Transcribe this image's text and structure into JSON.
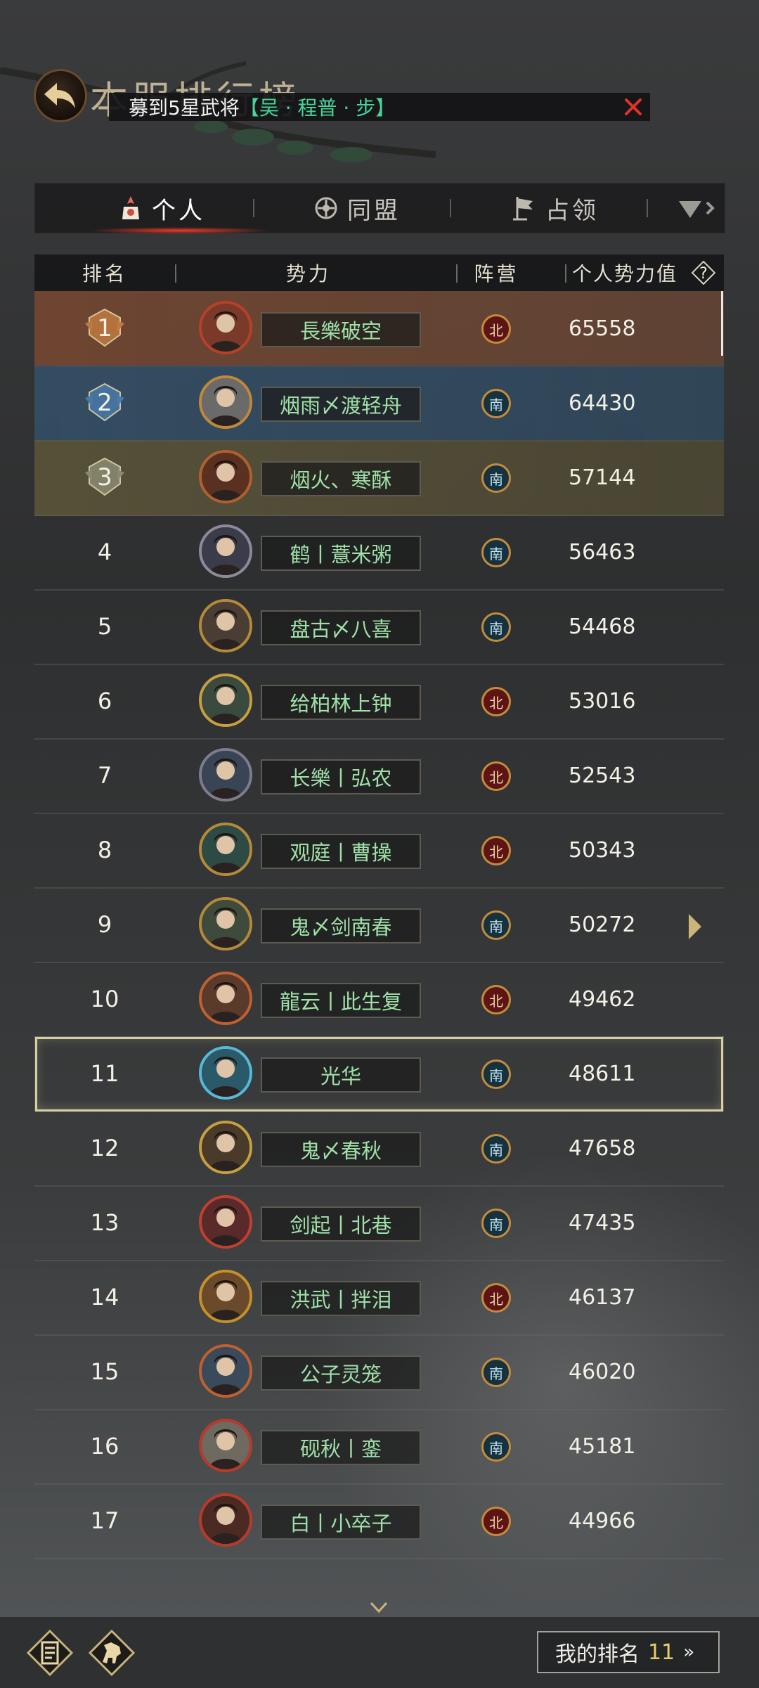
{
  "header": {
    "title": "本服排行榜"
  },
  "notice": {
    "prefix": "募到5星武将",
    "highlight": "【吴 · 程普 · 步】"
  },
  "tabs": [
    {
      "label": "个人"
    },
    {
      "label": "同盟"
    },
    {
      "label": "占领"
    }
  ],
  "columns": {
    "rank": "排名",
    "name": "势力",
    "faction": "阵营",
    "power": "个人势力值"
  },
  "rows": [
    {
      "rank": "1",
      "name": "長樂破空",
      "faction": "北",
      "power": "65558"
    },
    {
      "rank": "2",
      "name": "烟雨〆渡轻舟",
      "faction": "南",
      "power": "64430"
    },
    {
      "rank": "3",
      "name": "烟火、寒酥",
      "faction": "南",
      "power": "57144"
    },
    {
      "rank": "4",
      "name": "鹤丨薏米粥",
      "faction": "南",
      "power": "56463"
    },
    {
      "rank": "5",
      "name": "盘古〆八喜",
      "faction": "南",
      "power": "54468"
    },
    {
      "rank": "6",
      "name": "给柏林上钟",
      "faction": "北",
      "power": "53016"
    },
    {
      "rank": "7",
      "name": "长樂丨弘农",
      "faction": "北",
      "power": "52543"
    },
    {
      "rank": "8",
      "name": "观庭丨曹操",
      "faction": "北",
      "power": "50343"
    },
    {
      "rank": "9",
      "name": "鬼〆剑南春",
      "faction": "南",
      "power": "50272"
    },
    {
      "rank": "10",
      "name": "龍云丨此生复",
      "faction": "北",
      "power": "49462"
    },
    {
      "rank": "11",
      "name": "光华",
      "faction": "南",
      "power": "48611"
    },
    {
      "rank": "12",
      "name": "鬼〆春秋",
      "faction": "南",
      "power": "47658"
    },
    {
      "rank": "13",
      "name": "剑起丨北巷",
      "faction": "南",
      "power": "47435"
    },
    {
      "rank": "14",
      "name": "洪武丨拌泪",
      "faction": "北",
      "power": "46137"
    },
    {
      "rank": "15",
      "name": "公子灵笼",
      "faction": "南",
      "power": "46020"
    },
    {
      "rank": "16",
      "name": "砚秋丨銮",
      "faction": "南",
      "power": "45181"
    },
    {
      "rank": "17",
      "name": "白丨小卒子",
      "faction": "北",
      "power": "44966"
    }
  ],
  "my_rank": {
    "label": "我的排名",
    "value": "11",
    "arrow": "»"
  },
  "colors": {
    "highlight_green": "#47d69a",
    "name_green": "#9fe0a8",
    "rank_gold": "#e8cf6c",
    "north_red": "#5c1512",
    "south_blue": "#16323f"
  },
  "icons": [
    "back-arrow-icon",
    "close-icon",
    "personal-tab-icon",
    "alliance-tab-icon",
    "occupy-flag-icon",
    "more-tab-icon",
    "help-icon",
    "rank-badge-icon",
    "side-arrow-icon",
    "down-arrow-icon",
    "rankings-icon",
    "horse-icon"
  ]
}
